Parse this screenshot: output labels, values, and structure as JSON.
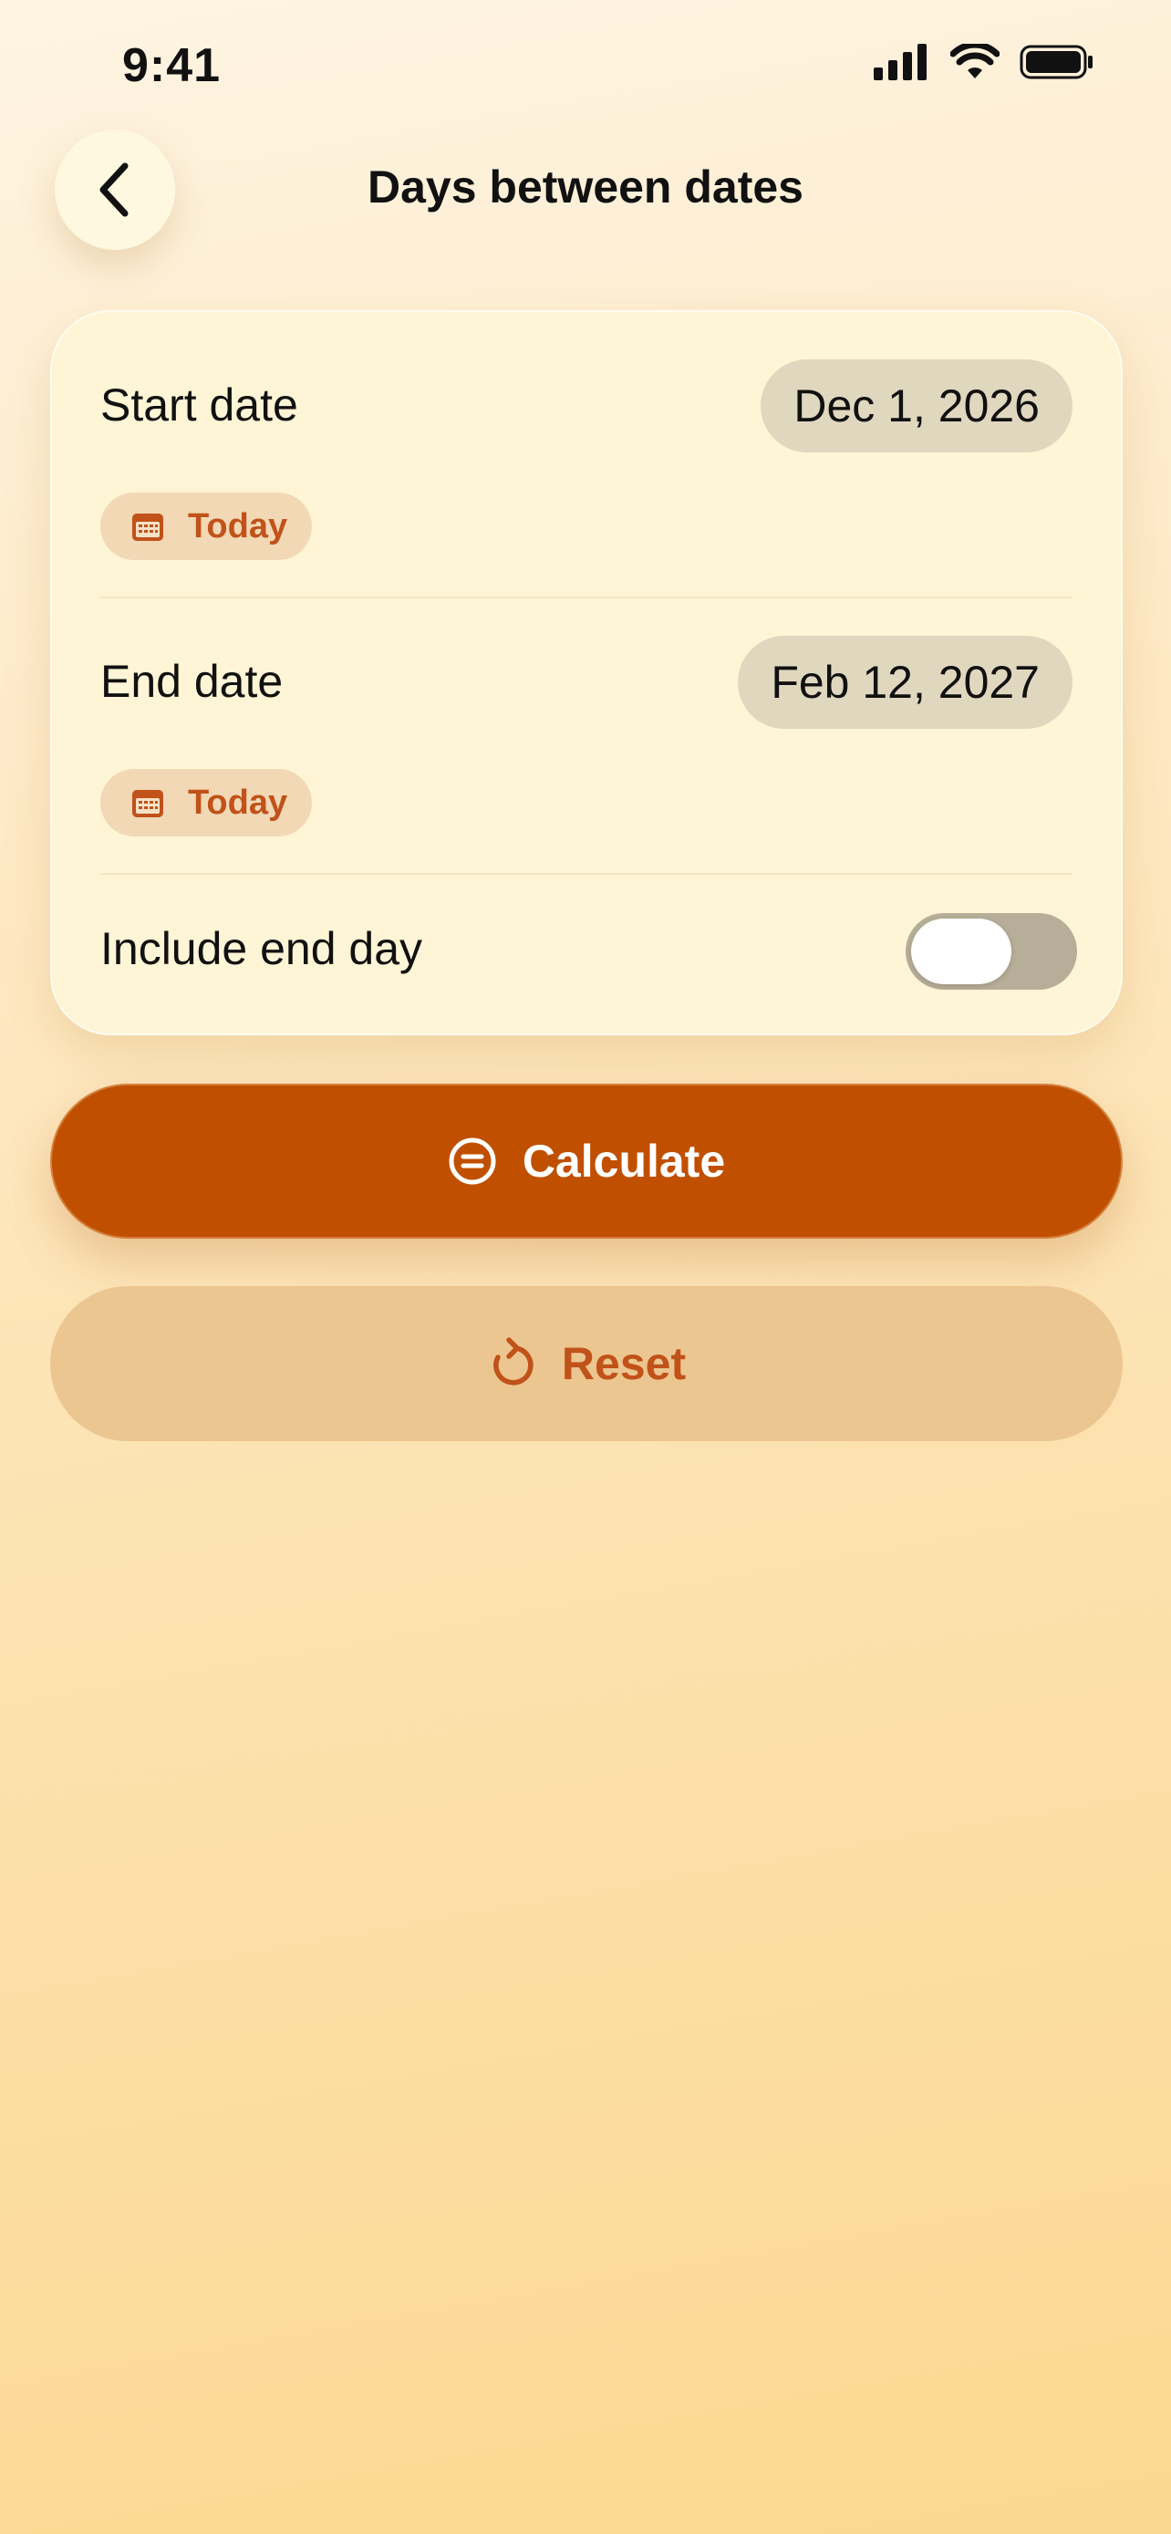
{
  "status_bar": {
    "time": "9:41"
  },
  "header": {
    "title": "Days between dates"
  },
  "form": {
    "start": {
      "label": "Start date",
      "value": "Dec 1, 2026",
      "today_label": "Today"
    },
    "end": {
      "label": "End date",
      "value": "Feb 12, 2027",
      "today_label": "Today"
    },
    "include_end_day": {
      "label": "Include end day",
      "on": false
    }
  },
  "actions": {
    "calculate_label": "Calculate",
    "reset_label": "Reset"
  },
  "icons": {
    "back": "chevron-left-icon",
    "calendar": "calendar-icon",
    "calculate": "equals-circle-icon",
    "reset": "refresh-icon"
  },
  "colors": {
    "accent": "#c05000",
    "chip_bg": "#f2d8b5",
    "reset_bg": "#ecc690"
  }
}
